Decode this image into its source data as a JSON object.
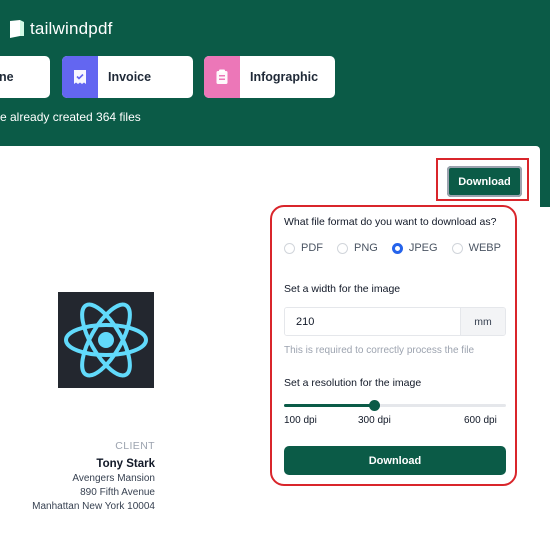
{
  "app": {
    "name": "tailwindpdf"
  },
  "templates": [
    {
      "label": "ne",
      "icon": "page-icon",
      "color": ""
    },
    {
      "label": "Invoice",
      "icon": "invoice-icon",
      "color": "#6366f1"
    },
    {
      "label": "Infographic",
      "icon": "infographic-icon",
      "color": "#ec77b8"
    }
  ],
  "tagline": "e already created 364 files",
  "toolbar": {
    "download_label": "Download"
  },
  "client": {
    "caption": "CLIENT",
    "name": "Tony Stark",
    "address1": "Avengers Mansion",
    "address2": "890 Fifth Avenue",
    "address3": "Manhattan New York 10004"
  },
  "download_panel": {
    "format_question": "What file format do you want to download as?",
    "formats": [
      "PDF",
      "PNG",
      "JPEG",
      "WEBP"
    ],
    "selected_format": "JPEG",
    "width_label": "Set a width for the image",
    "width_value": "210",
    "width_unit": "mm",
    "width_hint": "This is required to correctly process the file",
    "resolution_label": "Set a resolution for the image",
    "resolution_value": 300,
    "resolution_min": 100,
    "resolution_max": 600,
    "resolution_ticks": [
      "100 dpi",
      "300 dpi",
      "600 dpi"
    ],
    "download_label": "Download"
  },
  "colors": {
    "brand": "#0b5b47",
    "highlight": "#d9252b",
    "radio_selected": "#2563eb"
  }
}
